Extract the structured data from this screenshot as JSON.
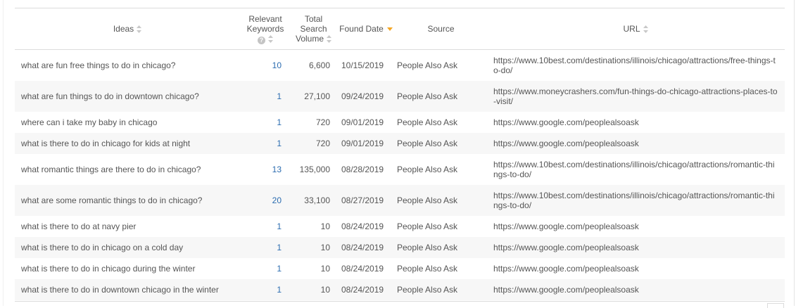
{
  "headers": {
    "ideas": "Ideas",
    "relevant_line1": "Relevant",
    "relevant_line2": "Keywords",
    "help_glyph": "?",
    "volume_line1": "Total",
    "volume_line2": "Search",
    "volume_line3": "Volume",
    "found_date": "Found Date",
    "source": "Source",
    "url": "URL"
  },
  "sort": {
    "active_column": "found_date",
    "direction": "descending",
    "active_color": "#f5a623"
  },
  "rows": [
    {
      "idea": "what are fun free things to do in chicago?",
      "keywords": "10",
      "volume": "6,600",
      "date": "10/15/2019",
      "source": "People Also Ask",
      "url": "https://www.10best.com/destinations/illinois/chicago/attractions/free-things-to-do/"
    },
    {
      "idea": "what are fun things to do in downtown chicago?",
      "keywords": "1",
      "volume": "27,100",
      "date": "09/24/2019",
      "source": "People Also Ask",
      "url": "https://www.moneycrashers.com/fun-things-do-chicago-attractions-places-to-visit/"
    },
    {
      "idea": "where can i take my baby in chicago",
      "keywords": "1",
      "volume": "720",
      "date": "09/01/2019",
      "source": "People Also Ask",
      "url": "https://www.google.com/peoplealsoask"
    },
    {
      "idea": "what is there to do in chicago for kids at night",
      "keywords": "1",
      "volume": "720",
      "date": "09/01/2019",
      "source": "People Also Ask",
      "url": "https://www.google.com/peoplealsoask"
    },
    {
      "idea": "what romantic things are there to do in chicago?",
      "keywords": "13",
      "volume": "135,000",
      "date": "08/28/2019",
      "source": "People Also Ask",
      "url": "https://www.10best.com/destinations/illinois/chicago/attractions/romantic-things-to-do/"
    },
    {
      "idea": "what are some romantic things to do in chicago?",
      "keywords": "20",
      "volume": "33,100",
      "date": "08/27/2019",
      "source": "People Also Ask",
      "url": "https://www.10best.com/destinations/illinois/chicago/attractions/romantic-things-to-do/"
    },
    {
      "idea": "what is there to do at navy pier",
      "keywords": "1",
      "volume": "10",
      "date": "08/24/2019",
      "source": "People Also Ask",
      "url": "https://www.google.com/peoplealsoask"
    },
    {
      "idea": "what is there to do in chicago on a cold day",
      "keywords": "1",
      "volume": "10",
      "date": "08/24/2019",
      "source": "People Also Ask",
      "url": "https://www.google.com/peoplealsoask"
    },
    {
      "idea": "what is there to do in chicago during the winter",
      "keywords": "1",
      "volume": "10",
      "date": "08/24/2019",
      "source": "People Also Ask",
      "url": "https://www.google.com/peoplealsoask"
    },
    {
      "idea": "what is there to do in downtown chicago in the winter",
      "keywords": "1",
      "volume": "10",
      "date": "08/24/2019",
      "source": "People Also Ask",
      "url": "https://www.google.com/peoplealsoask"
    }
  ]
}
